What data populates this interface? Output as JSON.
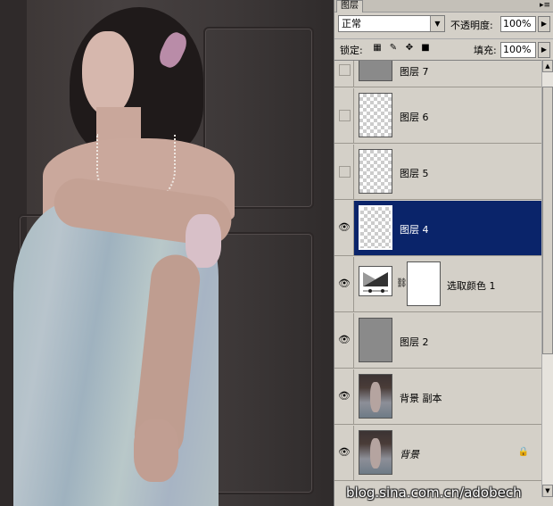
{
  "panel": {
    "tab_label": "图层",
    "menu_glyph": "▸≡",
    "blend_mode": "正常",
    "opacity_label": "不透明度:",
    "opacity_value": "100%",
    "lock_label": "锁定:",
    "fill_label": "填充:",
    "fill_value": "100%",
    "lock_icons": [
      "transparency-lock-icon",
      "brush-icon",
      "move-icon",
      "lock-icon"
    ]
  },
  "layers": [
    {
      "name": "图层 7",
      "visible": false,
      "thumb": "gray-sketch"
    },
    {
      "name": "图层 6",
      "visible": false,
      "thumb": "transparent"
    },
    {
      "name": "图层 5",
      "visible": false,
      "thumb": "transparent"
    },
    {
      "name": "图层 4",
      "visible": true,
      "selected": true,
      "thumb": "transparent"
    },
    {
      "name": "选取颜色 1",
      "visible": true,
      "thumb": "adjustment",
      "mask": true
    },
    {
      "name": "图层 2",
      "visible": true,
      "thumb": "gray"
    },
    {
      "name": "背景 副本",
      "visible": true,
      "thumb": "photo"
    },
    {
      "name": "背景",
      "visible": true,
      "thumb": "photo",
      "locked": true
    }
  ],
  "watermark": "blog.sina.com.cn/adobech",
  "colors": {
    "selection": "#0a246a",
    "panel_bg": "#d4d0c8",
    "canvas_bg": "#3a3434"
  }
}
